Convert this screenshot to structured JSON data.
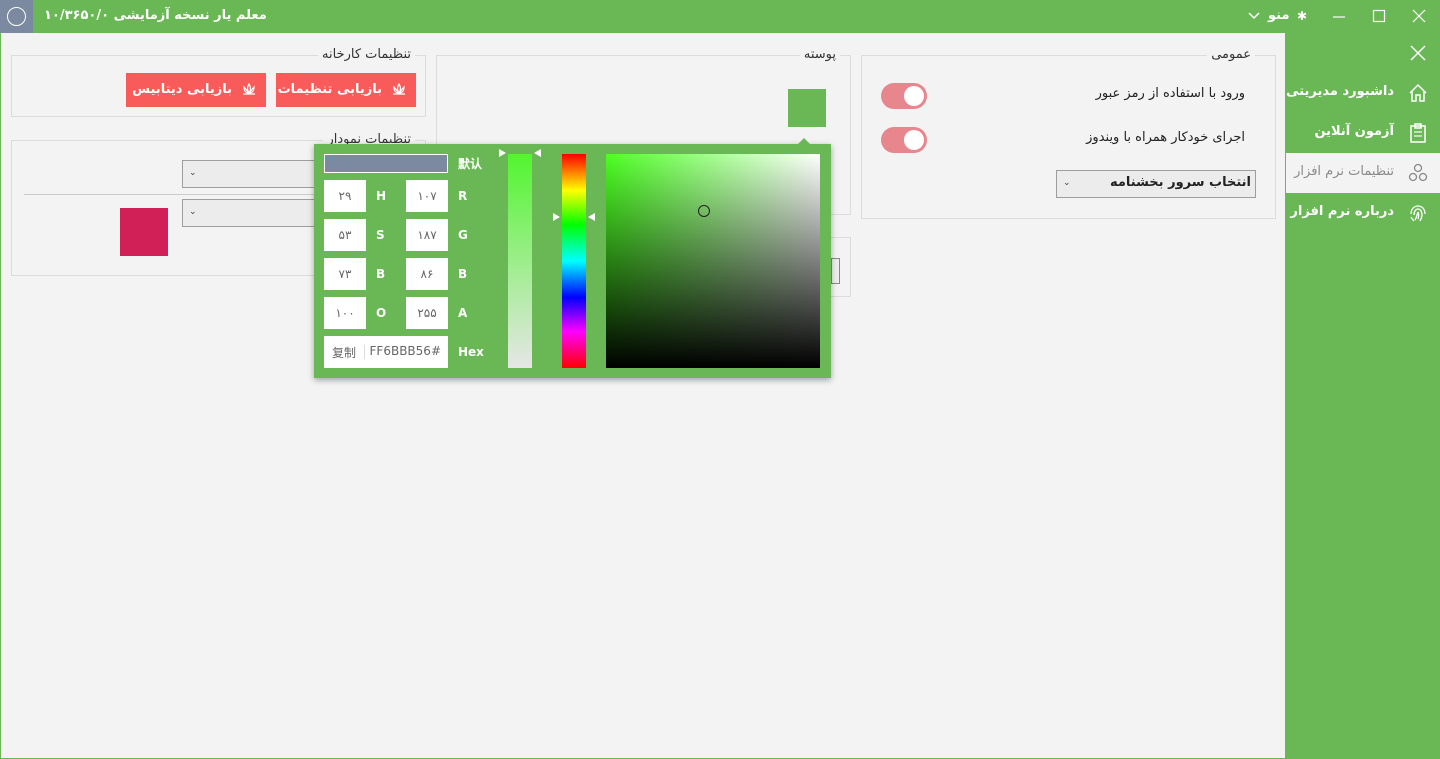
{
  "title_bar": {
    "title": "معلم یار نسخه آزمایشی ۱۰/۳۶۵۰/۰",
    "menu_label": "منو",
    "menu_gear_icon": "gear-icon",
    "chevron_icon": "chevron-down-icon"
  },
  "sidebar": {
    "items": [
      {
        "label": "داشبورد مدیریتی",
        "icon": "home-icon"
      },
      {
        "label": "آزمون آنلاین",
        "icon": "clipboard-icon"
      },
      {
        "label": "تنظیمات نرم افزار",
        "icon": "settings-icon",
        "active": true
      },
      {
        "label": "درباره نرم افزار",
        "icon": "fingerprint-icon"
      }
    ]
  },
  "general": {
    "title": "عمومی",
    "password_login_label": "ورود با استفاده از رمز عبور",
    "autostart_label": "اجرای خودکار همراه با ویندوز",
    "server_select_value": "انتخاب سرور بخشنامه"
  },
  "skin": {
    "title": "پوسته",
    "swatch_color": "#6ab855"
  },
  "factory": {
    "title": "تنظیمات کارخانه",
    "reset_settings_label": "بازیابی تنظیمات",
    "reset_database_label": "بازیابی دیتابیس"
  },
  "chart_settings": {
    "title": "تنظیمات نمودار",
    "swatch_color": "#d11f57"
  },
  "color_picker": {
    "default_label": "默认",
    "fields": {
      "H": "۲۹",
      "S": "۵۳",
      "B_hsb": "۷۳",
      "O": "۱۰۰",
      "R": "۱۰۷",
      "G": "۱۸۷",
      "B_rgb": "۸۶",
      "A": "۲۵۵"
    },
    "labels": {
      "H": "H",
      "S": "S",
      "B": "B",
      "O": "O",
      "R": "R",
      "G": "G",
      "A": "A",
      "Hex": "Hex"
    },
    "hex_value": "FF6BBB56#",
    "copy_label": "复制"
  },
  "colors": {
    "accent": "#6ab855",
    "danger": "#f95a5a",
    "toggle_on": "#e8868d",
    "chart_swatch": "#d11f57"
  }
}
